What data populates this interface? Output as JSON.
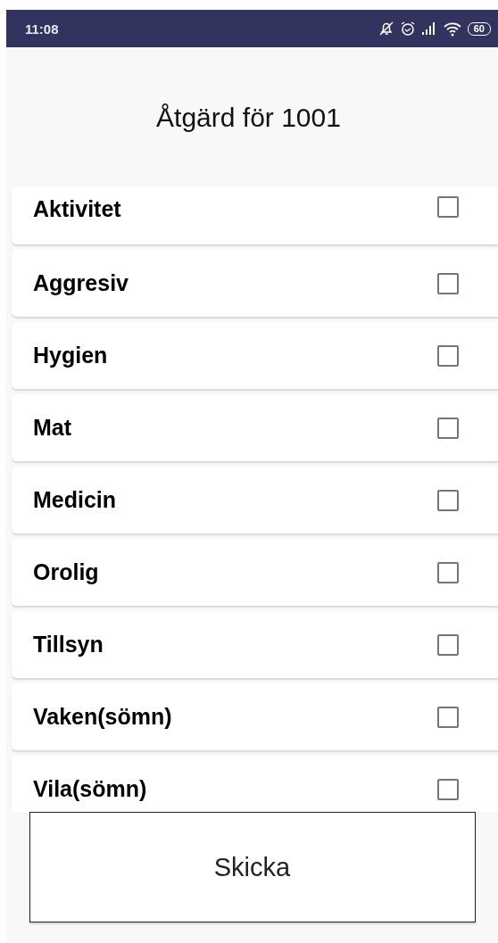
{
  "status_bar": {
    "time": "11:08",
    "battery": "60"
  },
  "title": "Åtgärd för 1001",
  "items": [
    {
      "label": "Aktivitet",
      "checked": false
    },
    {
      "label": "Aggresiv",
      "checked": false
    },
    {
      "label": "Hygien",
      "checked": false
    },
    {
      "label": "Mat",
      "checked": false
    },
    {
      "label": "Medicin",
      "checked": false
    },
    {
      "label": "Orolig",
      "checked": false
    },
    {
      "label": "Tillsyn",
      "checked": false
    },
    {
      "label": "Vaken(sömn)",
      "checked": false
    },
    {
      "label": "Vila(sömn)",
      "checked": false
    }
  ],
  "button": "Skicka"
}
